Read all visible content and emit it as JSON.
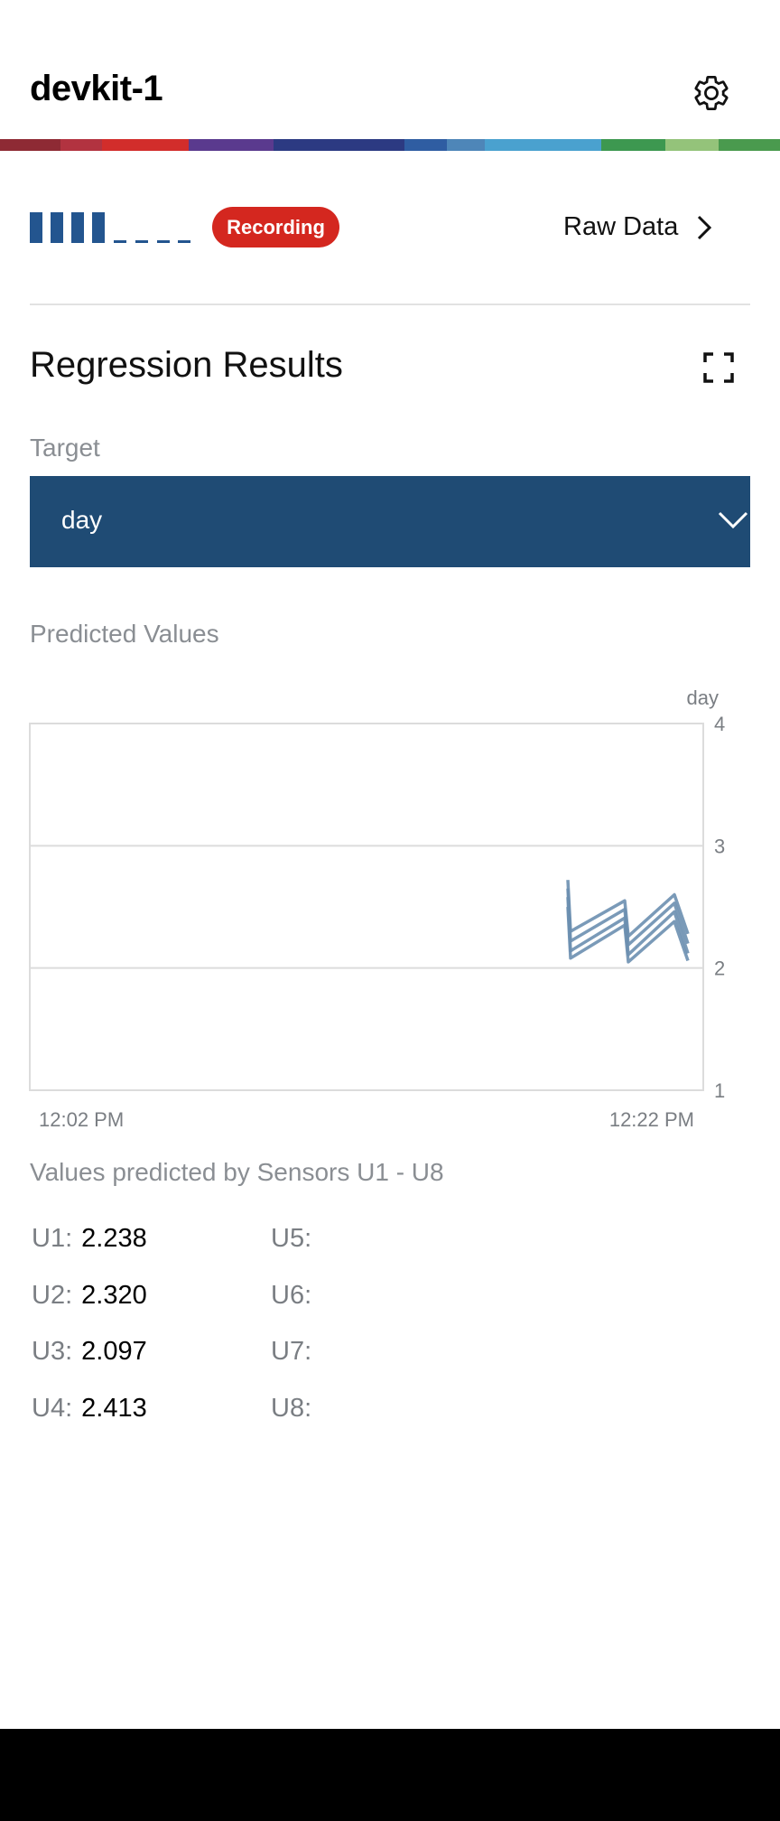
{
  "header": {
    "title": "devkit-1",
    "settings_icon": "gear-icon"
  },
  "status": {
    "signal_icon": "signal-strength-icon",
    "badge": "Recording",
    "badge_color": "#d4271f",
    "raw_data_label": "Raw Data"
  },
  "regression": {
    "title": "Regression Results",
    "expand_icon": "fullscreen-icon",
    "target_label": "Target",
    "target_value": "day",
    "select_color": "#1f4b74"
  },
  "predicted": {
    "title": "Predicted Values",
    "description": "Values predicted by Sensors U1 - U8"
  },
  "chart_data": {
    "type": "line",
    "ylabel": "day",
    "y_ticks": [
      "4",
      "3",
      "2",
      "1"
    ],
    "ylim": [
      1,
      4
    ],
    "x_ticks": [
      "12:02 PM",
      "12:22 PM"
    ],
    "grid": true,
    "line_color": "#6b8fb0",
    "series": [
      {
        "values": [
          2.72,
          2.3,
          2.55,
          2.26,
          2.6,
          2.28
        ]
      },
      {
        "values": [
          2.65,
          2.22,
          2.48,
          2.19,
          2.53,
          2.2
        ]
      },
      {
        "values": [
          2.58,
          2.14,
          2.41,
          2.11,
          2.46,
          2.12
        ]
      },
      {
        "values": [
          2.5,
          2.08,
          2.35,
          2.05,
          2.38,
          2.06
        ]
      }
    ]
  },
  "sensors": [
    {
      "key": "U1:",
      "value": "2.238"
    },
    {
      "key": "U2:",
      "value": "2.320"
    },
    {
      "key": "U3:",
      "value": "2.097"
    },
    {
      "key": "U4:",
      "value": "2.413"
    },
    {
      "key": "U5:",
      "value": ""
    },
    {
      "key": "U6:",
      "value": ""
    },
    {
      "key": "U7:",
      "value": ""
    },
    {
      "key": "U8:",
      "value": ""
    }
  ]
}
